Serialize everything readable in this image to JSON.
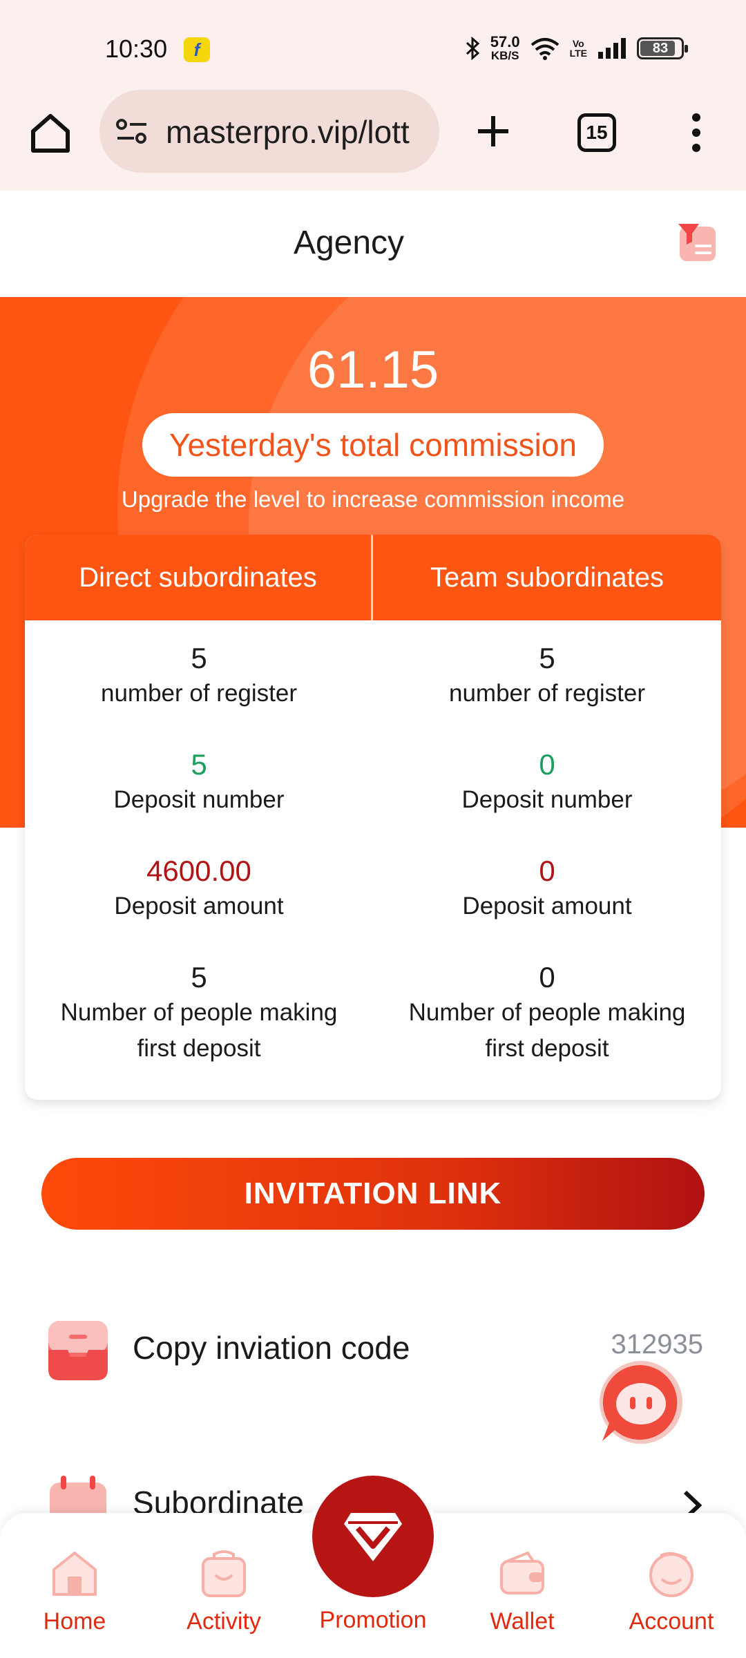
{
  "status_bar": {
    "time": "10:30",
    "app_badge": "f",
    "speed_value": "57.0",
    "speed_unit": "KB/S",
    "volte_top": "Vo",
    "volte_bottom": "LTE",
    "battery": "83",
    "battery_fraction": 0.83
  },
  "browser": {
    "url": "masterpro.vip/lott",
    "tab_count": "15"
  },
  "header": {
    "title": "Agency"
  },
  "banner": {
    "commission_value": "61.15",
    "commission_label": "Yesterday's total commission",
    "upgrade_text": "Upgrade the level to increase commission income"
  },
  "stats": {
    "tabs": [
      "Direct subordinates",
      "Team subordinates"
    ],
    "direct": {
      "register_count": "5",
      "register_label": "number of register",
      "deposit_number": "5",
      "deposit_number_label": "Deposit number",
      "deposit_amount": "4600.00",
      "deposit_amount_label": "Deposit amount",
      "first_deposit_count": "5",
      "first_deposit_label_1": "Number of people making",
      "first_deposit_label_2": "first deposit"
    },
    "team": {
      "register_count": "5",
      "register_label": "number of register",
      "deposit_number": "0",
      "deposit_number_label": "Deposit number",
      "deposit_amount": "0",
      "deposit_amount_label": "Deposit amount",
      "first_deposit_count": "0",
      "first_deposit_label_1": "Number of people making",
      "first_deposit_label_2": "first deposit"
    }
  },
  "invite": {
    "button_label": "INVITATION LINK"
  },
  "rows": {
    "copy_code_label": "Copy inviation code",
    "copy_code_value": "312935",
    "subordinate_label": "Subordinate"
  },
  "bottom_nav": {
    "items": [
      "Home",
      "Activity",
      "Promotion",
      "Wallet",
      "Account"
    ]
  },
  "colors": {
    "accent_orange": "#fe5512",
    "deep_red": "#b71514",
    "green": "#1d9e5e",
    "nav_text": "#e02a10"
  }
}
